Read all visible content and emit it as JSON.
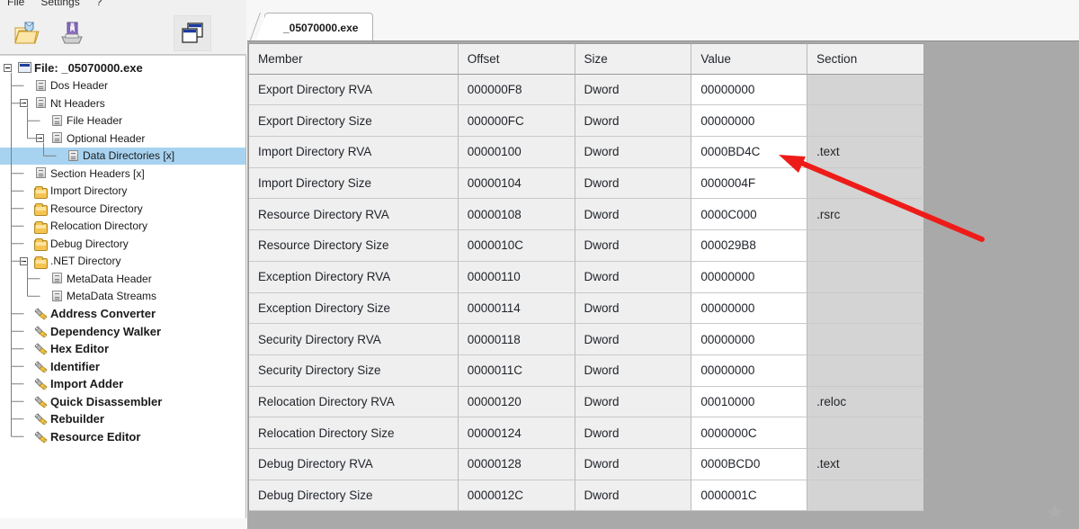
{
  "window": {
    "menu": [
      {
        "label": "File",
        "name": "menu-file"
      },
      {
        "label": "Settings",
        "name": "menu-settings"
      },
      {
        "label": "?",
        "name": "menu-help"
      }
    ],
    "toolbar": [
      {
        "name": "open-file-button",
        "icon": "open-folder-icon",
        "title": "Open"
      },
      {
        "name": "save-file-button",
        "icon": "save-floppy-icon",
        "title": "Save"
      },
      {
        "name": "cascade-windows-button",
        "icon": "cascade-windows-icon",
        "title": "Windows",
        "pressed": true
      }
    ]
  },
  "tab": {
    "label": "_05070000.exe",
    "active": true
  },
  "tree": {
    "selected": "Data Directories [x]",
    "items": [
      {
        "label": "File: _05070000.exe",
        "icon": "window-icon",
        "depth": 0,
        "bold": true,
        "expander": "minus",
        "selected": false
      },
      {
        "label": "Dos Header",
        "icon": "page-icon",
        "depth": 1,
        "bold": false,
        "expander": "",
        "selected": false
      },
      {
        "label": "Nt Headers",
        "icon": "page-icon",
        "depth": 1,
        "bold": false,
        "expander": "minus",
        "selected": false
      },
      {
        "label": "File Header",
        "icon": "page-icon",
        "depth": 2,
        "bold": false,
        "expander": "",
        "selected": false
      },
      {
        "label": "Optional Header",
        "icon": "page-icon",
        "depth": 2,
        "bold": false,
        "expander": "minus",
        "selected": false
      },
      {
        "label": "Data Directories [x]",
        "icon": "page-icon",
        "depth": 3,
        "bold": false,
        "expander": "",
        "selected": true
      },
      {
        "label": "Section Headers [x]",
        "icon": "page-icon",
        "depth": 1,
        "bold": false,
        "expander": "",
        "selected": false
      },
      {
        "label": "Import Directory",
        "icon": "folder-icon",
        "depth": 1,
        "bold": false,
        "expander": "",
        "selected": false
      },
      {
        "label": "Resource Directory",
        "icon": "folder-icon",
        "depth": 1,
        "bold": false,
        "expander": "",
        "selected": false
      },
      {
        "label": "Relocation Directory",
        "icon": "folder-icon",
        "depth": 1,
        "bold": false,
        "expander": "",
        "selected": false
      },
      {
        "label": "Debug Directory",
        "icon": "folder-icon",
        "depth": 1,
        "bold": false,
        "expander": "",
        "selected": false
      },
      {
        "label": ".NET Directory",
        "icon": "folder-icon",
        "depth": 1,
        "bold": false,
        "expander": "minus",
        "selected": false
      },
      {
        "label": "MetaData Header",
        "icon": "page-icon",
        "depth": 2,
        "bold": false,
        "expander": "",
        "selected": false
      },
      {
        "label": "MetaData Streams",
        "icon": "page-icon",
        "depth": 2,
        "bold": false,
        "expander": "",
        "selected": false
      },
      {
        "label": "Address Converter",
        "icon": "tool-icon",
        "depth": 1,
        "bold": true,
        "expander": "",
        "selected": false
      },
      {
        "label": "Dependency Walker",
        "icon": "tool-icon",
        "depth": 1,
        "bold": true,
        "expander": "",
        "selected": false
      },
      {
        "label": "Hex Editor",
        "icon": "tool-icon",
        "depth": 1,
        "bold": true,
        "expander": "",
        "selected": false
      },
      {
        "label": "Identifier",
        "icon": "tool-icon",
        "depth": 1,
        "bold": true,
        "expander": "",
        "selected": false
      },
      {
        "label": "Import Adder",
        "icon": "tool-icon",
        "depth": 1,
        "bold": true,
        "expander": "",
        "selected": false
      },
      {
        "label": "Quick Disassembler",
        "icon": "tool-icon",
        "depth": 1,
        "bold": true,
        "expander": "",
        "selected": false
      },
      {
        "label": "Rebuilder",
        "icon": "tool-icon",
        "depth": 1,
        "bold": true,
        "expander": "",
        "selected": false
      },
      {
        "label": "Resource Editor",
        "icon": "tool-icon",
        "depth": 1,
        "bold": true,
        "expander": "",
        "selected": false
      }
    ]
  },
  "table": {
    "columns": [
      "Member",
      "Offset",
      "Size",
      "Value",
      "Section"
    ],
    "rows": [
      {
        "member": "Export Directory RVA",
        "offset": "000000F8",
        "size": "Dword",
        "value": "00000000",
        "section": ""
      },
      {
        "member": "Export Directory Size",
        "offset": "000000FC",
        "size": "Dword",
        "value": "00000000",
        "section": ""
      },
      {
        "member": "Import Directory RVA",
        "offset": "00000100",
        "size": "Dword",
        "value": "0000BD4C",
        "section": ".text"
      },
      {
        "member": "Import Directory Size",
        "offset": "00000104",
        "size": "Dword",
        "value": "0000004F",
        "section": ""
      },
      {
        "member": "Resource Directory RVA",
        "offset": "00000108",
        "size": "Dword",
        "value": "0000C000",
        "section": ".rsrc"
      },
      {
        "member": "Resource Directory Size",
        "offset": "0000010C",
        "size": "Dword",
        "value": "000029B8",
        "section": ""
      },
      {
        "member": "Exception Directory RVA",
        "offset": "00000110",
        "size": "Dword",
        "value": "00000000",
        "section": ""
      },
      {
        "member": "Exception Directory Size",
        "offset": "00000114",
        "size": "Dword",
        "value": "00000000",
        "section": ""
      },
      {
        "member": "Security Directory RVA",
        "offset": "00000118",
        "size": "Dword",
        "value": "00000000",
        "section": ""
      },
      {
        "member": "Security Directory Size",
        "offset": "0000011C",
        "size": "Dword",
        "value": "00000000",
        "section": ""
      },
      {
        "member": "Relocation Directory RVA",
        "offset": "00000120",
        "size": "Dword",
        "value": "00010000",
        "section": ".reloc"
      },
      {
        "member": "Relocation Directory Size",
        "offset": "00000124",
        "size": "Dword",
        "value": "0000000C",
        "section": ""
      },
      {
        "member": "Debug Directory RVA",
        "offset": "00000128",
        "size": "Dword",
        "value": "0000BCD0",
        "section": ".text"
      },
      {
        "member": "Debug Directory Size",
        "offset": "0000012C",
        "size": "Dword",
        "value": "0000001C",
        "section": ""
      }
    ]
  },
  "annotation": {
    "type": "arrow",
    "color": "#ee1c18",
    "points_to_row": "Import Directory RVA",
    "points_to_value": "0000BD4C"
  },
  "colors": {
    "selection": "#a8d3f0",
    "header_bg": "#f0f0f0",
    "value_bg": "#ffffff",
    "section_bg": "#d4d4d4",
    "canvas_bg": "#a9a9a9",
    "annotation": "#ee1c18"
  }
}
